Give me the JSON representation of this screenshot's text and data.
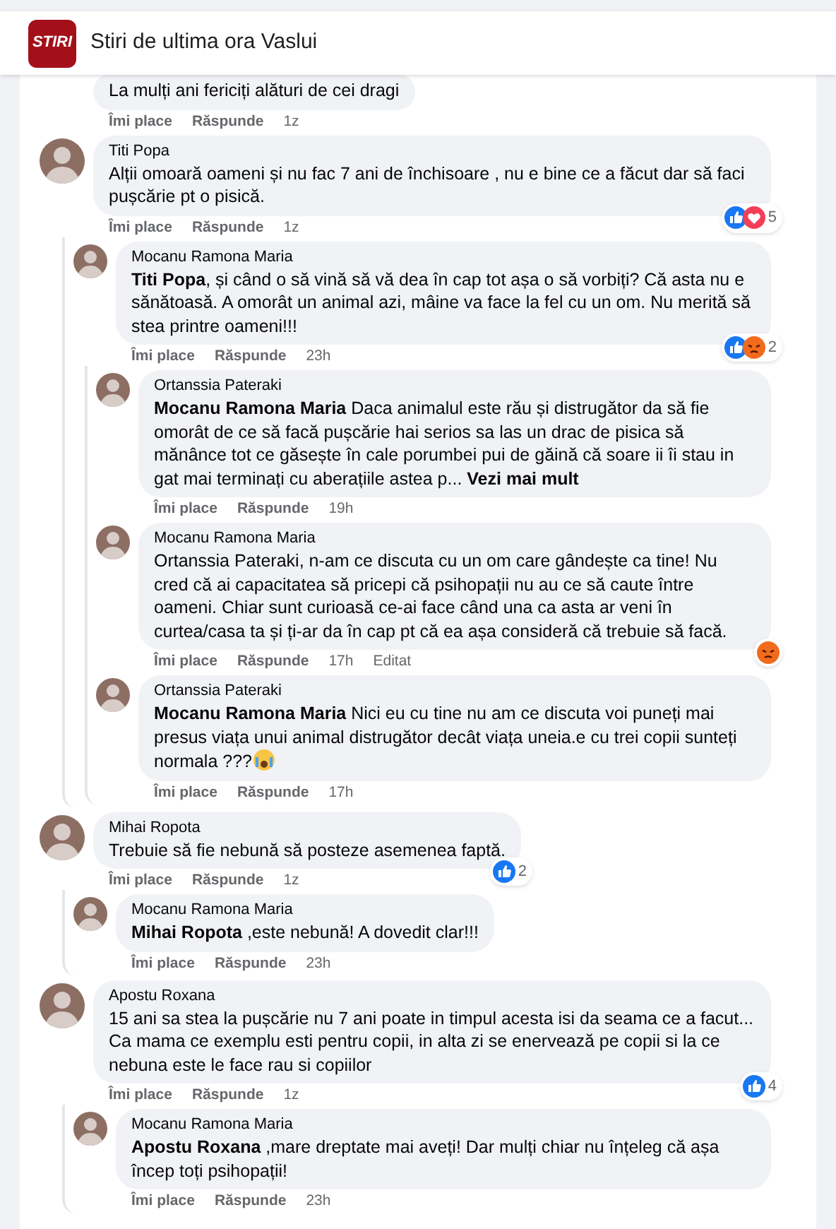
{
  "header": {
    "logo_text": "STIRI",
    "title": "Stiri de ultima ora Vaslui"
  },
  "comments": [
    {
      "text": "La mulți ani fericiți alături de cei dragi",
      "like_label": "Îmi place",
      "reply_label": "Răspunde",
      "time": "1z"
    },
    {
      "author": "Titi Popa",
      "text": "Alții omoară oameni și nu fac 7 ani de închisoare , nu e bine ce a făcut dar să faci pușcărie pt o pisică.",
      "like_label": "Îmi place",
      "reply_label": "Răspunde",
      "time": "1z",
      "reactions": {
        "icons": [
          {
            "kind": "like"
          },
          {
            "kind": "love"
          }
        ],
        "count": "5"
      },
      "children": [
        {
          "author": "Mocanu Ramona Maria",
          "text": "**Titi Popa**, și când o să vină să vă dea în cap tot așa o să vorbiți? Că asta nu e sănătoasă. A omorât un animal azi, mâine va face la fel cu un om. Nu merită să stea printre oameni!!!",
          "like_label": "Îmi place",
          "reply_label": "Răspunde",
          "time": "23h",
          "reactions": {
            "icons": [
              {
                "kind": "like"
              },
              {
                "kind": "angry"
              }
            ],
            "count": "2"
          },
          "children": [
            {
              "author": "Ortanssia Pateraki",
              "text": "**Mocanu Ramona Maria** Daca animalul este rău și distrugător da să fie omorât de ce să facă pușcărie hai serios sa las un drac de pisica să mănânce tot ce găsește în cale porumbei pui de găină că soare ii îi stau in gat mai terminați cu aberațiile astea p...",
              "see_more": "Vezi mai mult",
              "like_label": "Îmi place",
              "reply_label": "Răspunde",
              "time": "19h"
            },
            {
              "author": "Mocanu Ramona Maria",
              "text": "Ortanssia Pateraki, n-am ce discuta cu un om care gândește ca tine! Nu cred că ai capacitatea să pricepi că psihopații nu au ce să caute între oameni. Chiar sunt curioasă ce-ai face când una ca asta ar veni în curtea/casa ta și ți-ar da în cap pt că ea așa consideră că trebuie să facă.",
              "like_label": "Îmi place",
              "reply_label": "Răspunde",
              "time": "17h",
              "edited": "Editat",
              "reactions": {
                "icons": [
                  {
                    "kind": "angry"
                  }
                ]
              }
            },
            {
              "author": "Ortanssia Pateraki",
              "text": "**Mocanu Ramona Maria** Nici eu cu tine nu am ce discuta voi puneți mai presus viața unui animal distrugător decât viața uneia.e cu trei copii sunteți normala ???",
              "trailing_emoji": {
                "kind": "cry"
              },
              "like_label": "Îmi place",
              "reply_label": "Răspunde",
              "time": "17h"
            }
          ]
        }
      ]
    },
    {
      "author": "Mihai Ropota",
      "text": "Trebuie să fie nebună să posteze asemenea faptă.",
      "like_label": "Îmi place",
      "reply_label": "Răspunde",
      "time": "1z",
      "reactions": {
        "icons": [
          {
            "kind": "like"
          }
        ],
        "count": "2"
      },
      "children": [
        {
          "author": "Mocanu Ramona Maria",
          "text": "**Mihai Ropota** ,este nebună! A dovedit clar!!!",
          "like_label": "Îmi place",
          "reply_label": "Răspunde",
          "time": "23h"
        }
      ]
    },
    {
      "author": "Apostu Roxana",
      "text": "15 ani sa stea la pușcărie nu 7 ani poate in timpul acesta isi da seama ce a facut... Ca mama ce exemplu esti pentru copii, in alta zi se enervează pe copii si la ce nebuna este le face rau si copiilor",
      "like_label": "Îmi place",
      "reply_label": "Răspunde",
      "time": "1z",
      "reactions": {
        "icons": [
          {
            "kind": "like"
          }
        ],
        "count": "4"
      },
      "children": [
        {
          "author": "Mocanu Ramona Maria",
          "text": "**Apostu Roxana** ,mare dreptate mai aveți! Dar mulți chiar nu înțeleg că așa încep toți psihopații!",
          "like_label": "Îmi place",
          "reply_label": "Răspunde",
          "time": "23h"
        }
      ]
    }
  ]
}
